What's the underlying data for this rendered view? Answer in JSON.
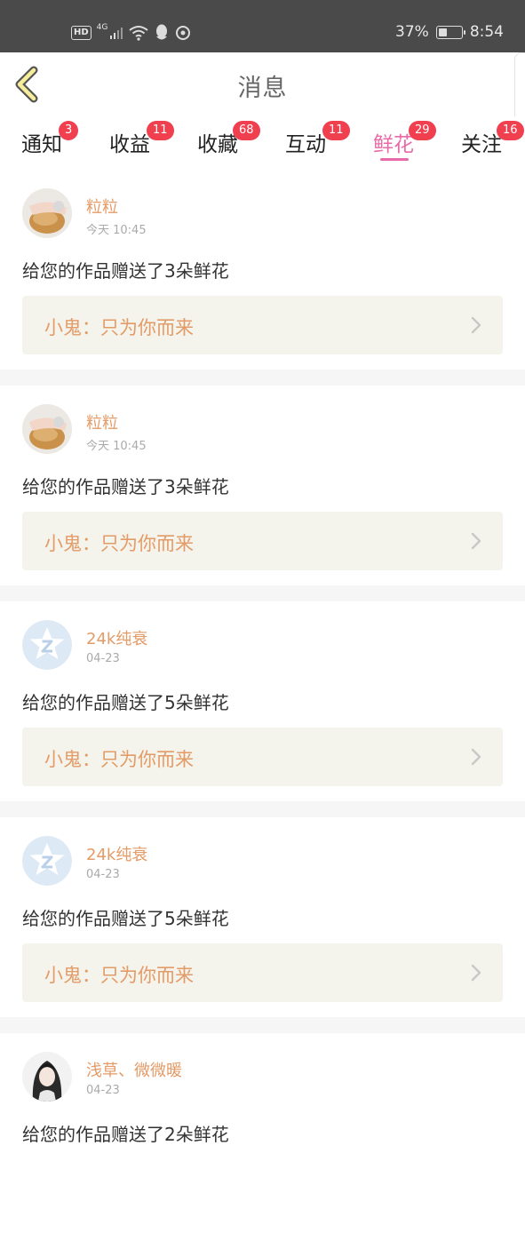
{
  "status_bar": {
    "hd": "HD",
    "network": "4G",
    "battery": "37%",
    "battery_level": 0.37,
    "time": "8:54"
  },
  "header": {
    "title": "消息"
  },
  "tabs": [
    {
      "label": "通知",
      "badge": "3"
    },
    {
      "label": "收益",
      "badge": "11"
    },
    {
      "label": "收藏",
      "badge": "68"
    },
    {
      "label": "互动",
      "badge": "11"
    },
    {
      "label": "鲜花",
      "badge": "29",
      "active": true
    },
    {
      "label": "关注",
      "badge": "16"
    }
  ],
  "items": [
    {
      "nickname": "粒粒",
      "time": "今天 10:45",
      "message": "给您的作品赠送了3朵鲜花",
      "work": "小鬼：只为你而来",
      "avatar": "photo-avatar"
    },
    {
      "nickname": "粒粒",
      "time": "今天 10:45",
      "message": "给您的作品赠送了3朵鲜花",
      "work": "小鬼：只为你而来",
      "avatar": "photo-avatar"
    },
    {
      "nickname": "24k纯衰",
      "time": "04-23",
      "message": "给您的作品赠送了5朵鲜花",
      "work": "小鬼：只为你而来",
      "avatar": "default-star-avatar"
    },
    {
      "nickname": "24k纯衰",
      "time": "04-23",
      "message": "给您的作品赠送了5朵鲜花",
      "work": "小鬼：只为你而来",
      "avatar": "default-star-avatar"
    },
    {
      "nickname": "浅草、微微暖",
      "time": "04-23",
      "message": "给您的作品赠送了2朵鲜花",
      "avatar": "anime-avatar"
    }
  ],
  "colors": {
    "accent": "#e86aa8",
    "nickname": "#e39b67",
    "badge": "#f04050",
    "card_bg": "#f4f4ec"
  }
}
